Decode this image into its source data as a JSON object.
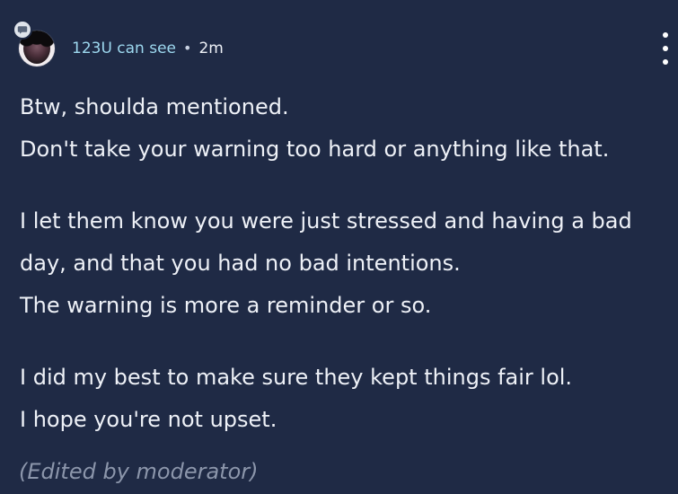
{
  "post": {
    "visibility": "123U can see",
    "separator": "•",
    "timestamp": "2m",
    "body_lines": [
      "Btw, shoulda mentioned.",
      "Don't take your warning too hard or anything like that.",
      "I let them know you were just stressed and having a bad",
      "day, and that you had no bad intentions.",
      "The warning is more a reminder or so.",
      "I did my best to make sure they kept things fair lol.",
      "I hope you're not upset."
    ],
    "edited_note": "(Edited by moderator)",
    "icons": {
      "avatar": "avatar",
      "badge": "chat-bubble-icon",
      "menu": "more-vertical-icon"
    },
    "colors": {
      "background": "#1f2a45",
      "text": "#eef1f7",
      "visibility": "#9dd8ef",
      "edited": "#8c96ab"
    }
  }
}
